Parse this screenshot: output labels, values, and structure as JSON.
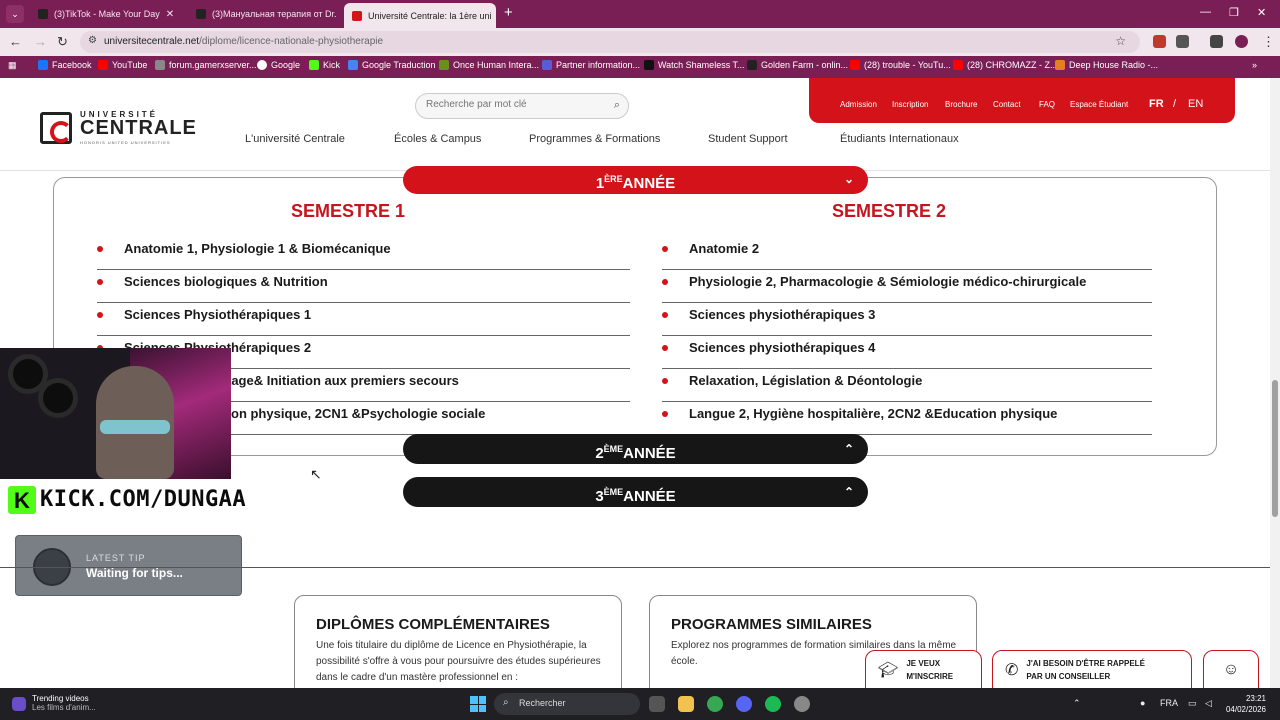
{
  "browser": {
    "tabs": [
      {
        "label": "(3)TikTok - Make Your Day",
        "active": false
      },
      {
        "label": "(3)Мануальная терапия от Dr.",
        "active": false
      },
      {
        "label": "Université Centrale: la 1ère uni",
        "active": true
      }
    ],
    "url_domain": "universitecentrale.net",
    "url_path": "/diplome/licence-nationale-physiotherapie",
    "bookmarks": [
      "Facebook",
      "YouTube",
      "forum.gamerxserver...",
      "Google",
      "Kick",
      "Google Traduction",
      "Once Human Intera...",
      "Partner information...",
      "Watch Shameless T...",
      "Golden Farm - onlin...",
      "(28) trouble - YouTu...",
      "(28) CHROMAZZ - Z...",
      "Deep House Radio -..."
    ]
  },
  "site": {
    "logo": {
      "line1": "UNIVERSITÉ",
      "line2": "CENTRALE",
      "line3": "HONORIS UNITED UNIVERSITIES"
    },
    "search_placeholder": "Recherche par mot clé",
    "top_links": [
      "Admission",
      "Inscription",
      "Brochure",
      "Contact",
      "FAQ",
      "Espace Étudiant"
    ],
    "languages": [
      "FR",
      "/",
      "EN"
    ],
    "nav": [
      "L'université Centrale",
      "Écoles & Campus",
      "Programmes & Formations",
      "Student Support",
      "Étudiants Internationaux"
    ]
  },
  "curriculum": {
    "years": [
      {
        "num": "1",
        "sup": "ÈRE",
        "word": "ANNÉE",
        "expanded": true
      },
      {
        "num": "2",
        "sup": "ÈME",
        "word": "ANNÉE",
        "expanded": false
      },
      {
        "num": "3",
        "sup": "ÈME",
        "word": "ANNÉE",
        "expanded": false
      }
    ],
    "semester1": {
      "title": "SEMESTRE 1",
      "courses": [
        "Anatomie 1, Physiologie 1 & Biomécanique",
        "Sciences biologiques & Nutrition",
        "Sciences Physiothérapiques 1",
        "Sciences Physiothérapiques 2",
        "tage& Initiation aux premiers secours",
        "on physique, 2CN1 &Psychologie sociale"
      ]
    },
    "semester2": {
      "title": "SEMESTRE 2",
      "courses": [
        "Anatomie 2",
        "Physiologie 2, Pharmacologie & Sémiologie médico-chirurgicale",
        "Sciences physiothérapiques 3",
        "Sciences physiothérapiques 4",
        "Relaxation, Législation & Déontologie",
        "Langue 2, Hygiène hospitalière, 2CN2 &Education physique"
      ]
    }
  },
  "overlay": {
    "kick_url": "KICK.COM/DUNGAA",
    "tip_label": "LATEST TIP",
    "tip_value": "Waiting for tips..."
  },
  "cards": [
    {
      "title": "DIPLÔMES COMPLÉMENTAIRES",
      "text": "Une fois titulaire du diplôme de Licence en Physiothérapie, la possibilité s'offre à vous pour poursuivre des études supérieures dans le cadre d'un mastère professionnel en :"
    },
    {
      "title": "PROGRAMMES SIMILAIRES",
      "text": "Explorez nos programmes de formation similaires dans la même école."
    }
  ],
  "ctas": [
    {
      "label": "JE VEUX\nM'INSCRIRE",
      "icon": "graduation-cap-icon"
    },
    {
      "label": "J'AI BESOIN D'ÊTRE RAPPELÉ\nPAR UN CONSEILLER",
      "icon": "phone-icon"
    }
  ],
  "taskbar": {
    "news_title": "Trending videos",
    "news_sub": "Les films d'anim...",
    "search": "Rechercher",
    "lang": "FRA",
    "time": "23:21",
    "date": "04/02/2026"
  },
  "colors": {
    "brand_red": "#d4121a",
    "chrome": "#7a1f55",
    "kick_green": "#53fc18"
  }
}
